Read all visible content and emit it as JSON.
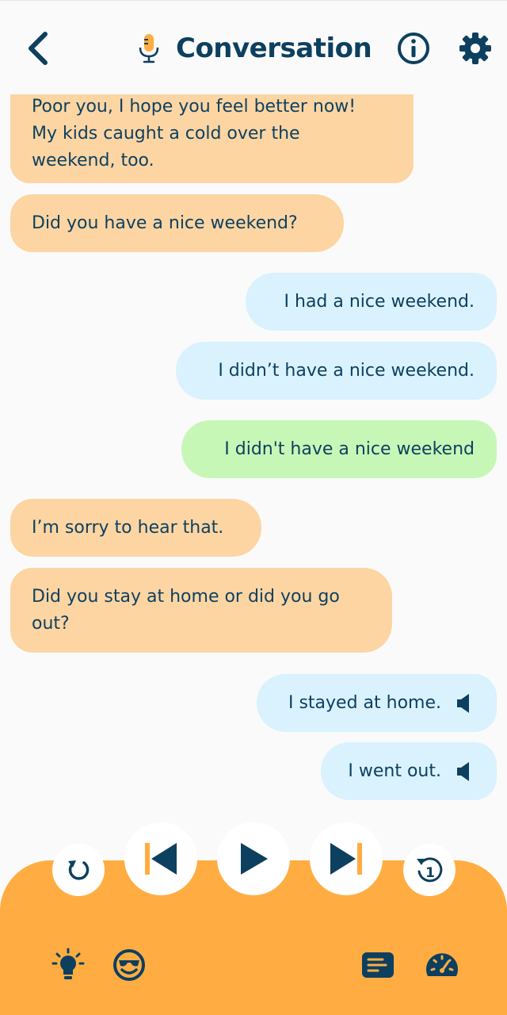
{
  "header": {
    "title": "Conversation",
    "icons": {
      "back": "chevron-left-icon",
      "mic": "microphone-icon",
      "info": "info-icon",
      "settings": "gear-icon"
    }
  },
  "messages": [
    {
      "side": "left",
      "text": "Poor you, I hope you feel better now!\nMy kids caught a cold over the\nweekend, too."
    },
    {
      "side": "left",
      "text": "Did you have a nice weekend?"
    },
    {
      "side": "right",
      "text": "I had a nice weekend."
    },
    {
      "side": "right",
      "text": "I didn’t have a nice weekend."
    },
    {
      "side": "user",
      "text": "I didn't have a nice weekend"
    },
    {
      "side": "left",
      "text": "I’m sorry to hear that."
    },
    {
      "side": "left",
      "text": "Did you stay at home or did you go\nout?"
    },
    {
      "side": "right",
      "text": "I stayed at home.",
      "icon": "speaker-icon"
    },
    {
      "side": "right",
      "text": "I went out.",
      "icon": "speaker-icon"
    }
  ],
  "player": {
    "controls": [
      "replay-icon",
      "skip-previous-icon",
      "play-icon",
      "skip-next-icon",
      "repeat-one-icon"
    ],
    "repeat_count": "1"
  },
  "toolbar": {
    "icons": [
      "lightbulb-icon",
      "smiley-sunglasses-icon",
      "transcript-icon",
      "speedometer-icon"
    ]
  },
  "colors": {
    "primary": "#0d3f5f",
    "accent": "#ffad42",
    "bubble_left": "#fdd5a3",
    "bubble_right": "#d9f2fd",
    "bubble_user": "#c6f7b7",
    "background": "#fafafa"
  }
}
